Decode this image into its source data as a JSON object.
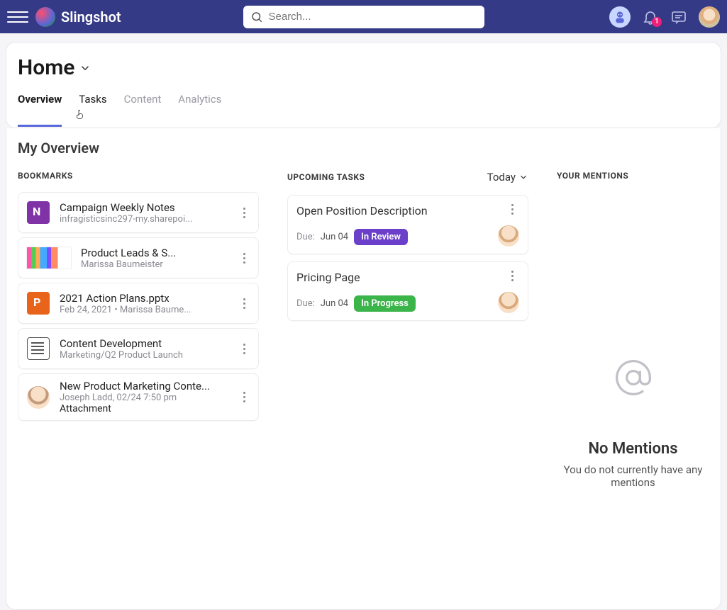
{
  "header": {
    "brand": "Slingshot",
    "search_placeholder": "Search...",
    "notification_count": "1"
  },
  "page": {
    "title": "Home"
  },
  "tabs": [
    {
      "label": "Overview",
      "state": "active"
    },
    {
      "label": "Tasks",
      "state": "hovered"
    },
    {
      "label": "Content",
      "state": "default"
    },
    {
      "label": "Analytics",
      "state": "default"
    }
  ],
  "overview": {
    "section_title": "My Overview",
    "bookmarks": {
      "heading": "BOOKMARKS",
      "items": [
        {
          "icon": "onenote",
          "title": "Campaign Weekly Notes",
          "subtitle": "infragisticsinc297-my.sharepoi..."
        },
        {
          "icon": "chart",
          "title": "Product Leads & S...",
          "subtitle": "Marissa Baumeister"
        },
        {
          "icon": "ppt",
          "title": "2021 Action Plans.pptx",
          "subtitle": "Feb 24, 2021 • Marissa Baume..."
        },
        {
          "icon": "doc",
          "title": "Content Development",
          "subtitle": "Marketing/Q2 Product Launch"
        },
        {
          "icon": "face",
          "title": "New Product Marketing Conte...",
          "subtitle": "Joseph Ladd, 02/24 7:50 pm",
          "subtitle2": "Attachment"
        }
      ]
    },
    "upcoming": {
      "heading": "UPCOMING TASKS",
      "filter_label": "Today",
      "due_label": "Due:",
      "items": [
        {
          "title": "Open Position Description",
          "due": "Jun 04",
          "status": "In Review",
          "status_class": "pill-review"
        },
        {
          "title": "Pricing Page",
          "due": "Jun 04",
          "status": "In Progress",
          "status_class": "pill-progress"
        }
      ]
    },
    "mentions": {
      "heading": "YOUR MENTIONS",
      "empty_title": "No Mentions",
      "empty_subtitle": "You do not currently have any mentions"
    }
  }
}
